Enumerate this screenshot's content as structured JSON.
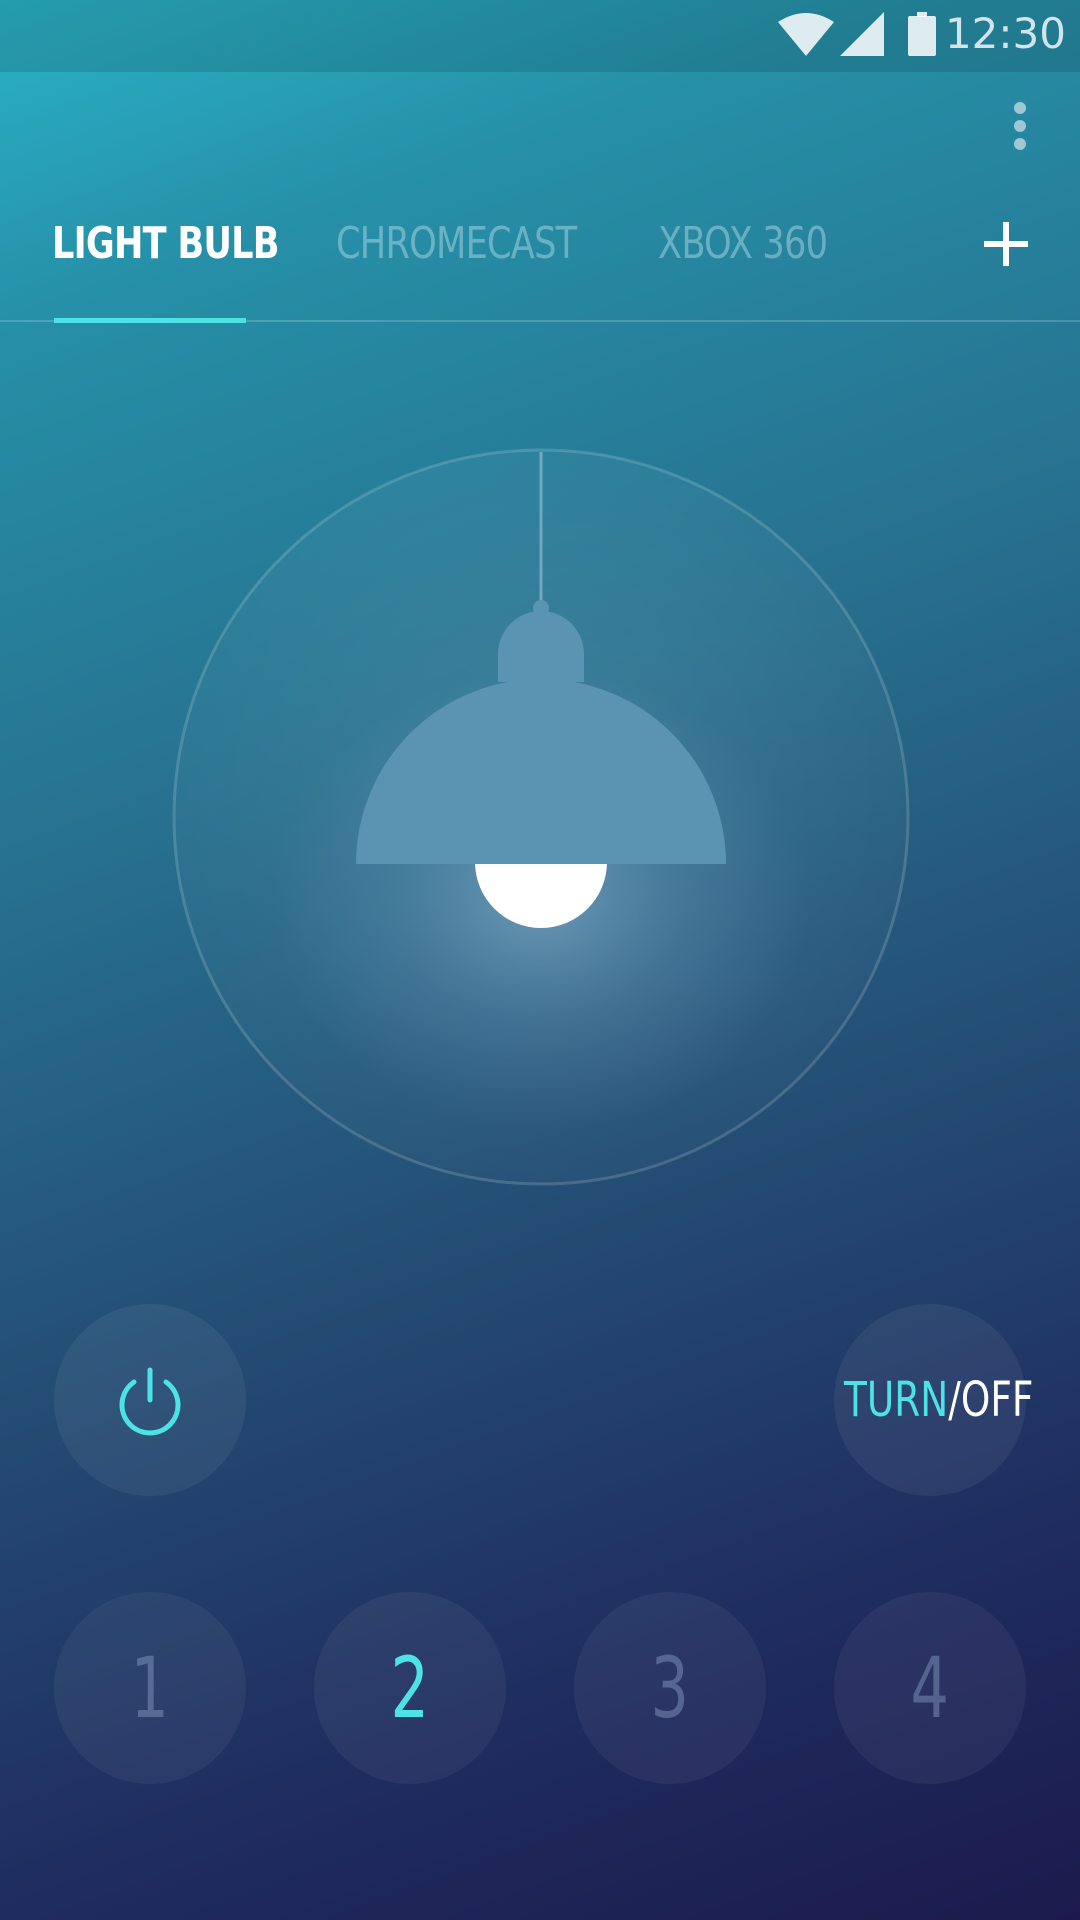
{
  "status_bar": {
    "time": "12:30",
    "icons": [
      "wifi-icon",
      "cell-signal-icon",
      "battery-icon"
    ]
  },
  "header": {
    "overflow_icon": "more-vert-icon",
    "add_icon": "plus-icon"
  },
  "tabs": [
    {
      "label": "LIGHT BULB",
      "active": true
    },
    {
      "label": "CHROMECAST",
      "active": false
    },
    {
      "label": "XBOX 360",
      "active": false
    }
  ],
  "controls": {
    "power_icon": "power-icon",
    "turn_label": "TURN",
    "slash": "/",
    "off_label": "OFF"
  },
  "presets": [
    {
      "label": "1",
      "active": false
    },
    {
      "label": "2",
      "active": true
    },
    {
      "label": "3",
      "active": false
    },
    {
      "label": "4",
      "active": false
    }
  ],
  "colors": {
    "accent": "#4de3e6",
    "lamp_shade": "#5b93b3",
    "bulb": "#ffffff"
  }
}
